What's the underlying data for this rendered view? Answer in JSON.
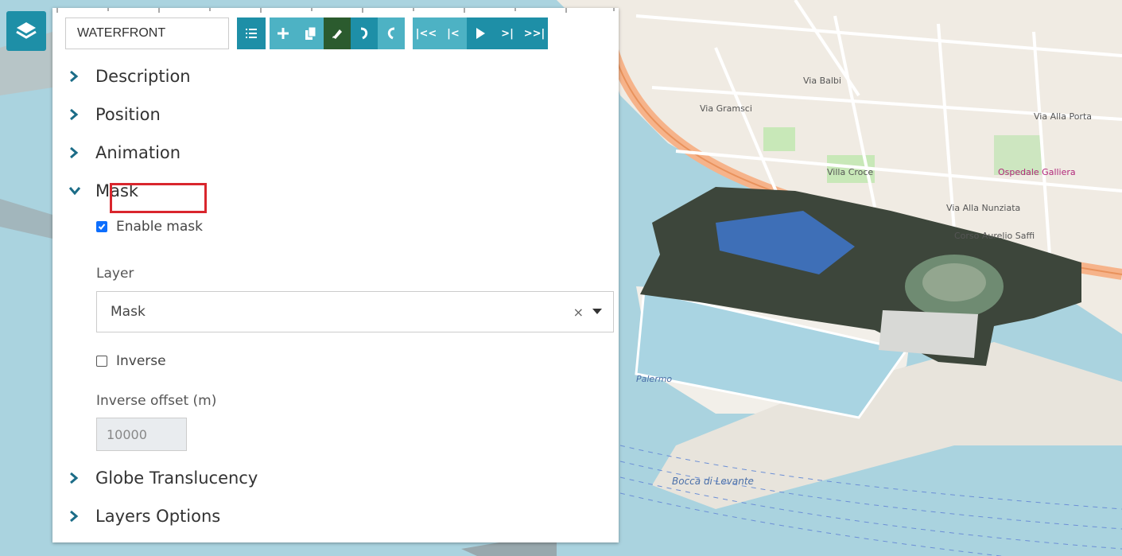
{
  "map": {
    "labels": [
      "Via Balbi",
      "Via Gramsci",
      "Via Alla Nunziata",
      "Villa Croce",
      "Via Alla Porta",
      "Ospedale Galliera",
      "Corso Aurelio Saffi",
      "Palermo",
      "Bocca di Levante"
    ]
  },
  "toolbar": {
    "name_value": "WATERFRONT",
    "buttons": {
      "list": "list-icon",
      "add": "plus-icon",
      "copy": "copy-icon",
      "edit": "pencil-icon",
      "undo": "undo-icon",
      "redo": "redo-icon",
      "first": "first-icon",
      "prev": "prev-icon",
      "play": "play-icon",
      "next": "next-icon",
      "last": "last-icon"
    },
    "colors": {
      "teal": "#1e8fa7",
      "light": "#4db2c4",
      "green": "#2b5b2e"
    }
  },
  "sections": {
    "description": "Description",
    "position": "Position",
    "animation": "Animation",
    "mask": "Mask",
    "globe": "Globe Translucency",
    "layers": "Layers Options"
  },
  "mask": {
    "enable_label": "Enable mask",
    "enable_checked": true,
    "layer_label": "Layer",
    "layer_value": "Mask",
    "clear_symbol": "×",
    "inverse_label": "Inverse",
    "inverse_checked": false,
    "offset_label": "Inverse offset (m)",
    "offset_value": "10000"
  },
  "highlight_color": "#d9262d"
}
